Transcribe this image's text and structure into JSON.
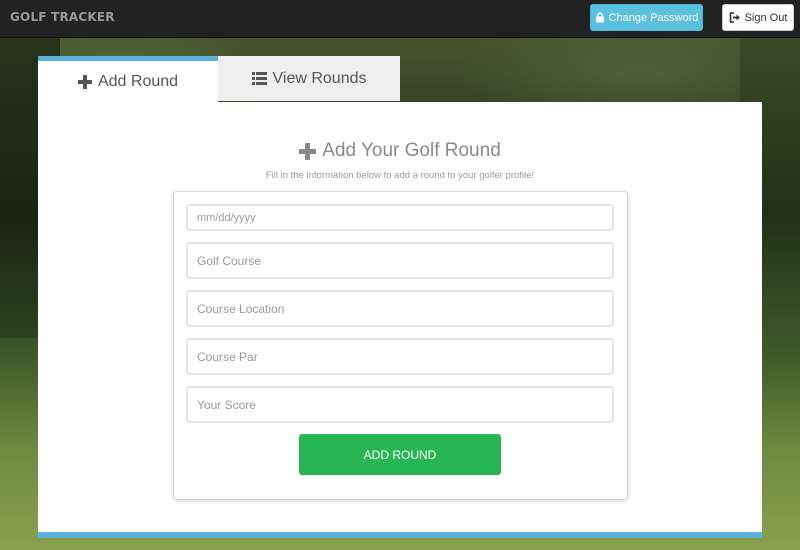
{
  "navbar": {
    "brand": "GOLF TRACKER",
    "change_password_label": "Change Password",
    "change_password_icon": "lock-icon",
    "sign_out_label": "Sign Out",
    "sign_out_icon": "sign-out-icon"
  },
  "tabs": [
    {
      "label": "Add Round",
      "icon": "plus-icon",
      "active": true
    },
    {
      "label": "View Rounds",
      "icon": "list-icon",
      "active": false
    }
  ],
  "form": {
    "title": "Add Your Golf Round",
    "subtitle": "Fill in the information below to add a round to your golfer profile!",
    "fields": {
      "date_placeholder": "mm/dd/yyyy",
      "course_placeholder": "Golf Course",
      "location_placeholder": "Course Location",
      "par_placeholder": "Course Par",
      "score_placeholder": "Your Score"
    },
    "submit_label": "ADD ROUND"
  },
  "colors": {
    "accent": "#5bb3d9",
    "info_button": "#5bc0de",
    "success_button": "#28b553",
    "navbar": "#222222"
  }
}
